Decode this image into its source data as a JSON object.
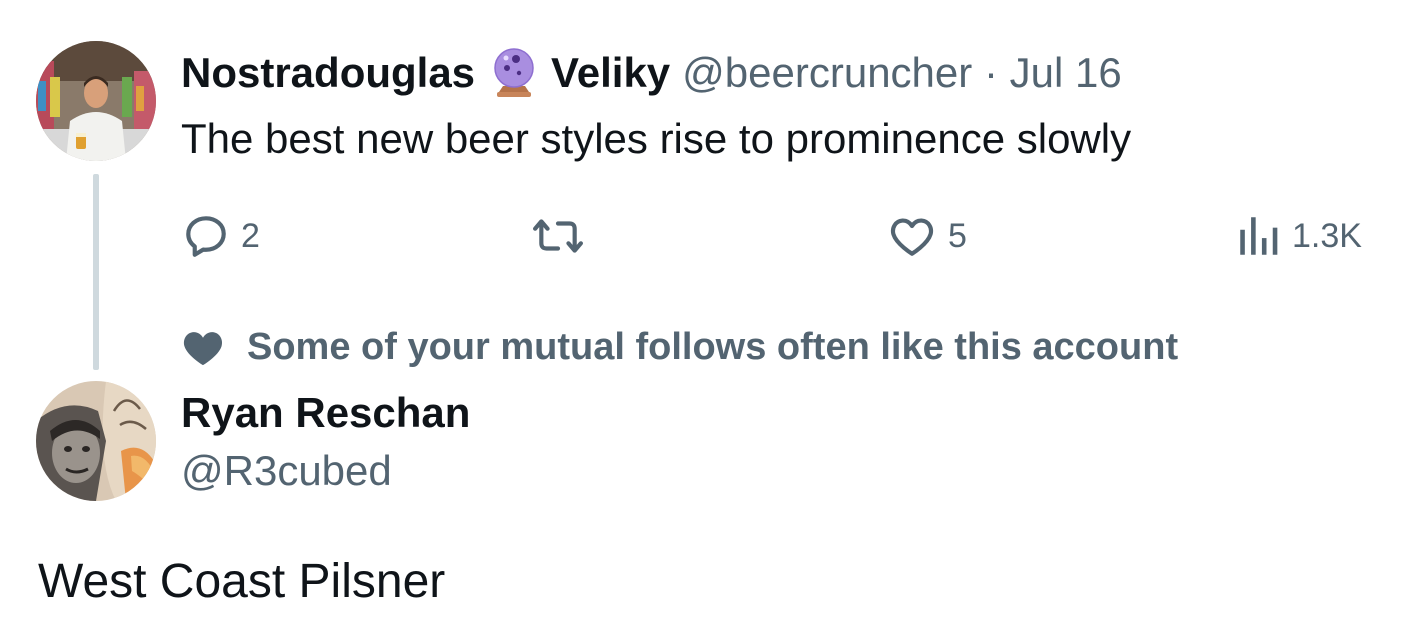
{
  "parent_tweet": {
    "avatar_icon": "user-avatar-man-white-shirt",
    "display_name_first": "Nostradouglas",
    "name_emoji": "crystal-ball-icon",
    "display_name_last": "Veliky",
    "handle": "@beercruncher",
    "separator": "·",
    "date": "Jul 16",
    "text": "The best new beer styles rise to prominence slowly",
    "actions": {
      "reply": {
        "icon": "reply-icon",
        "count": "2"
      },
      "retweet": {
        "icon": "retweet-icon",
        "count": ""
      },
      "like": {
        "icon": "heart-icon",
        "count": "5"
      },
      "views": {
        "icon": "views-icon",
        "count": "1.3K"
      }
    }
  },
  "social_context": {
    "icon": "heart-fill-icon",
    "text": "Some of your mutual follows often like this account"
  },
  "reply_tweet": {
    "avatar_icon": "user-avatar-mural-portrait",
    "display_name": "Ryan Reschan",
    "handle": "@R3cubed",
    "text": "West Coast Pilsner"
  },
  "colors": {
    "text_primary": "#0f1419",
    "text_secondary": "#536471",
    "thread_line": "#cfd9de",
    "background": "#ffffff"
  }
}
